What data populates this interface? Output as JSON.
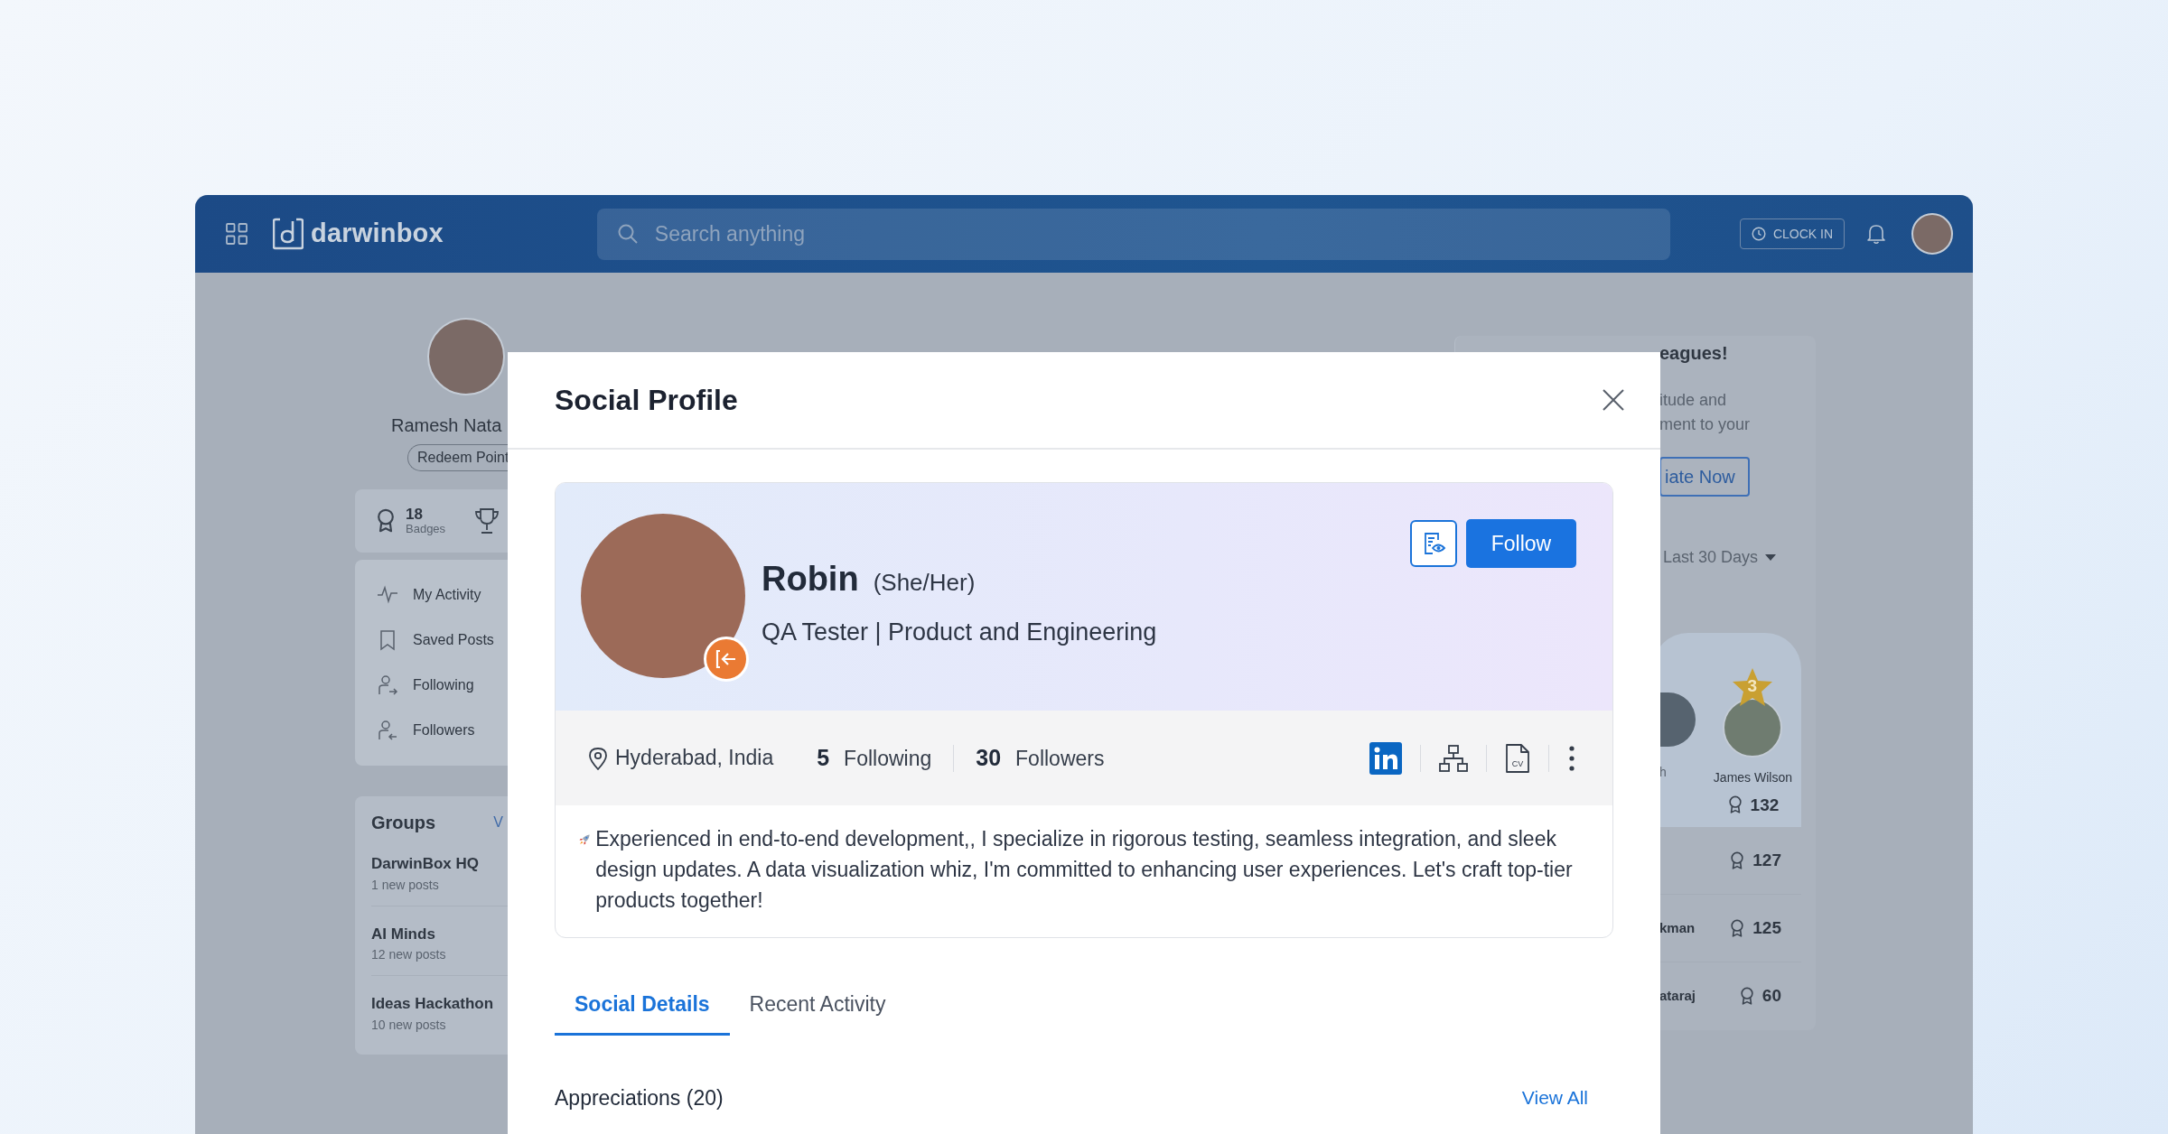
{
  "header": {
    "logo": "darwinbox",
    "search": {
      "placeholder": "Search anything"
    },
    "clock_in": "CLOCK IN"
  },
  "left": {
    "user_name": "Ramesh Nata",
    "redeem": "Redeem Point",
    "badges": {
      "count": "18",
      "label": "Badges"
    },
    "menu": [
      {
        "label": "My Activity",
        "kind": "activity"
      },
      {
        "label": "Saved Posts",
        "kind": "saved"
      },
      {
        "label": "Following",
        "kind": "following"
      },
      {
        "label": "Followers",
        "kind": "followers"
      }
    ],
    "groups": {
      "title": "Groups",
      "link": "V",
      "items": [
        {
          "name": "DarwinBox HQ",
          "meta": "1 new posts"
        },
        {
          "name": "AI Minds",
          "meta": "12 new posts"
        },
        {
          "name": "Ideas Hackathon",
          "meta": "10 new posts"
        }
      ]
    }
  },
  "right": {
    "title": "eagues!",
    "text_lines": [
      "itude and",
      "ment to your"
    ],
    "button": "iate Now",
    "filter": "Last 30 Days",
    "podium": {
      "partial_name": "h",
      "rank": "3",
      "name": "James Wilson",
      "points": "132"
    },
    "leaders": [
      {
        "points": "127"
      },
      {
        "name": "kman",
        "points": "125"
      },
      {
        "name": "ataraj",
        "points": "60"
      }
    ]
  },
  "modal": {
    "title": "Social Profile",
    "profile": {
      "name": "Robin",
      "pronouns": "(She/Her)",
      "role": "QA Tester | Product and Engineering",
      "follow": "Follow",
      "cv_label": "CV",
      "location": "Hyderabad, India",
      "following_count": "5",
      "following_label": "Following",
      "followers_count": "30",
      "followers_label": "Followers",
      "bio": "Experienced in end-to-end development,, I specialize in rigorous testing, seamless integration, and sleek design updates. A data visualization whiz, I'm committed to enhancing user experiences. Let's craft top-tier products together!"
    },
    "tabs": [
      {
        "label": "Social Details",
        "selected": true
      },
      {
        "label": "Recent Activity",
        "selected": false
      }
    ],
    "appreciations": {
      "title": "Appreciations (20)",
      "link": "View All"
    }
  }
}
